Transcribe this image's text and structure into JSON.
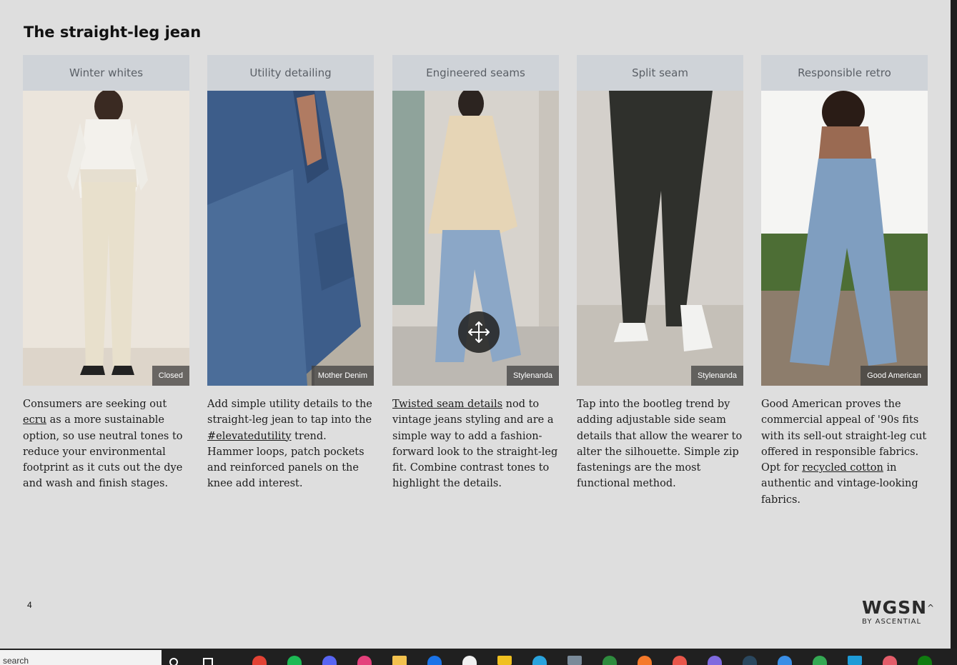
{
  "slide": {
    "title": "The straight-leg jean",
    "page_number": "4"
  },
  "cards": [
    {
      "heading": "Winter whites",
      "credit": "Closed",
      "text_before": "Consumers are seeking out ",
      "link": "ecru",
      "text_after": " as a more sustainable option, so use neutral tones to reduce your environmental footprint as it cuts out the dye and wash and finish stages."
    },
    {
      "heading": "Utility detailing",
      "credit": "Mother Denim",
      "text_before": "Add simple utility details to the straight-leg jean to tap into the ",
      "link": "#elevatedutility",
      "text_after": " trend. Hammer loops, patch pockets and reinforced panels on the knee add interest."
    },
    {
      "heading": "Engineered seams",
      "credit": "Stylenanda",
      "text_before": "",
      "link": "Twisted seam details",
      "text_after": " nod to vintage jeans styling and are a simple way to add a fashion-forward look to the straight-leg fit. Combine contrast tones to highlight the details."
    },
    {
      "heading": "Split seam",
      "credit": "Stylenanda",
      "text_before": "Tap into the bootleg trend by adding adjustable side seam details that allow the wearer to alter the silhouette. Simple zip fastenings are the most functional method.",
      "link": "",
      "text_after": ""
    },
    {
      "heading": "Responsible retro",
      "credit": "Good American",
      "text_before": "Good American proves the commercial appeal of '90s fits with its sell-out straight-leg cut offered in responsible fabrics. Opt for ",
      "link": "recycled cotton",
      "text_after": " in authentic and vintage-looking fabrics."
    }
  ],
  "logo": {
    "main": "WGSN",
    "sub": "BY ASCENTIAL"
  },
  "taskbar": {
    "search_placeholder": "search"
  },
  "icons": [
    "move-icon",
    "search-icon",
    "task-view-icon",
    "chrome-icon",
    "spotify-icon",
    "discord-icon",
    "folder-icon",
    "mail-icon",
    "steam-icon",
    "xbox-icon"
  ],
  "colors": {
    "background": "#dedede",
    "card_header": "#cfd3d8",
    "taskbar": "#202020"
  }
}
